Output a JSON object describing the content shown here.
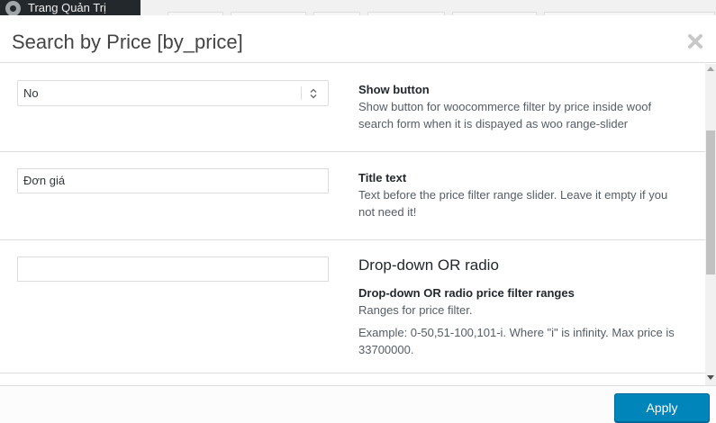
{
  "admin_bar": {
    "site_name": "Trang Quản Trị"
  },
  "modal": {
    "title": "Search by Price [by_price]",
    "close_icon": "close-icon"
  },
  "rows": [
    {
      "field_type": "select",
      "value": "No",
      "title": "Show button",
      "text": "Show button for woocommerce filter by price inside woof search form when it is dispayed as woo range-slider"
    },
    {
      "field_type": "text",
      "value": "Đơn giá",
      "title": "Title text",
      "text": "Text before the price filter range slider. Leave it empty if you not need it!"
    },
    {
      "field_type": "text",
      "value": "",
      "heading": "Drop-down OR radio",
      "title": "Drop-down OR radio price filter ranges",
      "text": "Ranges for price filter.",
      "example": "Example: 0-50,51-100,101-i. Where \"i\" is infinity. Max price is 33700000."
    }
  ],
  "footer": {
    "apply_label": "Apply"
  },
  "colors": {
    "primary_button": "#0085ba",
    "border": "#dddddd",
    "admin_bar": "#23282d"
  }
}
